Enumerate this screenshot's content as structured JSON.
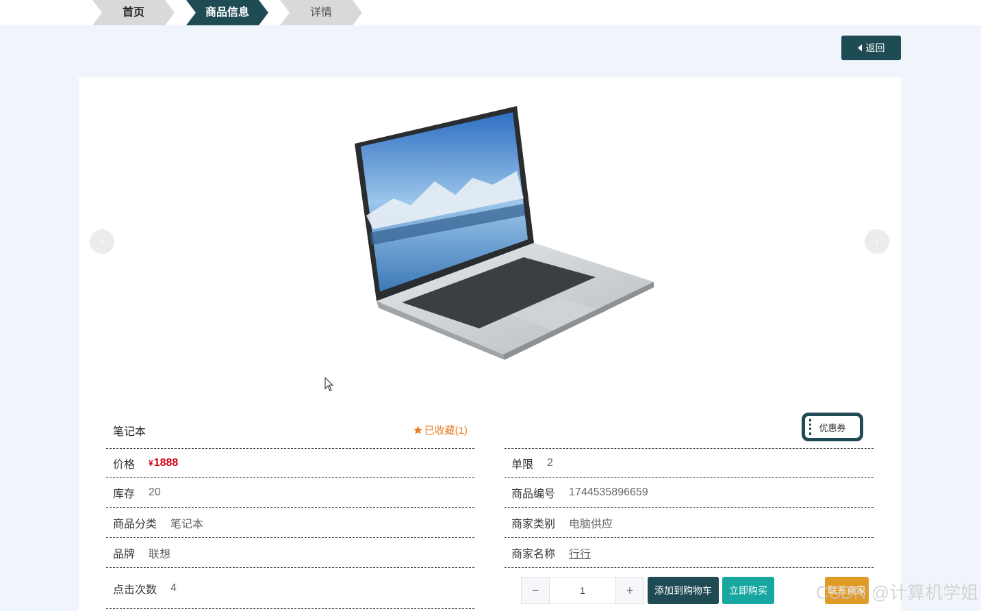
{
  "breadcrumb": {
    "items": [
      {
        "label": "首页"
      },
      {
        "label": "商品信息"
      },
      {
        "label": "详情"
      }
    ]
  },
  "colors": {
    "accent": "#1f4b55",
    "teal": "#17a7a0",
    "price": "#d0021b",
    "favorite": "#e67e22",
    "orange": "#e09a26",
    "stage": "#f0f5fc"
  },
  "back_button": {
    "label": "返回",
    "icon": "caret-left-icon"
  },
  "carousel": {
    "prev_label": "‹",
    "next_label": "›"
  },
  "product": {
    "name": "笔记本",
    "favorite": {
      "label": "已收藏(1)",
      "icon": "star-icon"
    },
    "coupon_label": "优惠券",
    "left_fields": [
      {
        "label": "价格",
        "currency": "¥",
        "value": "1888"
      },
      {
        "label": "库存",
        "value": "20"
      },
      {
        "label": "商品分类",
        "value": "笔记本"
      },
      {
        "label": "品牌",
        "value": "联想"
      },
      {
        "label": "点击次数",
        "value": "4"
      }
    ],
    "right_fields": [
      {
        "label": "单限",
        "value": "2"
      },
      {
        "label": "商品编号",
        "value": "1744535896659"
      },
      {
        "label": "商家类别",
        "value": "电脑供应"
      },
      {
        "label": "商家名称",
        "value": "行行"
      }
    ]
  },
  "quantity": {
    "minus": "−",
    "value": "1",
    "plus": "+"
  },
  "actions": {
    "add_to_cart": "添加到购物车",
    "buy_now": "立即购买",
    "extra": "联系商家"
  },
  "watermark": "CSDN @计算机学姐"
}
